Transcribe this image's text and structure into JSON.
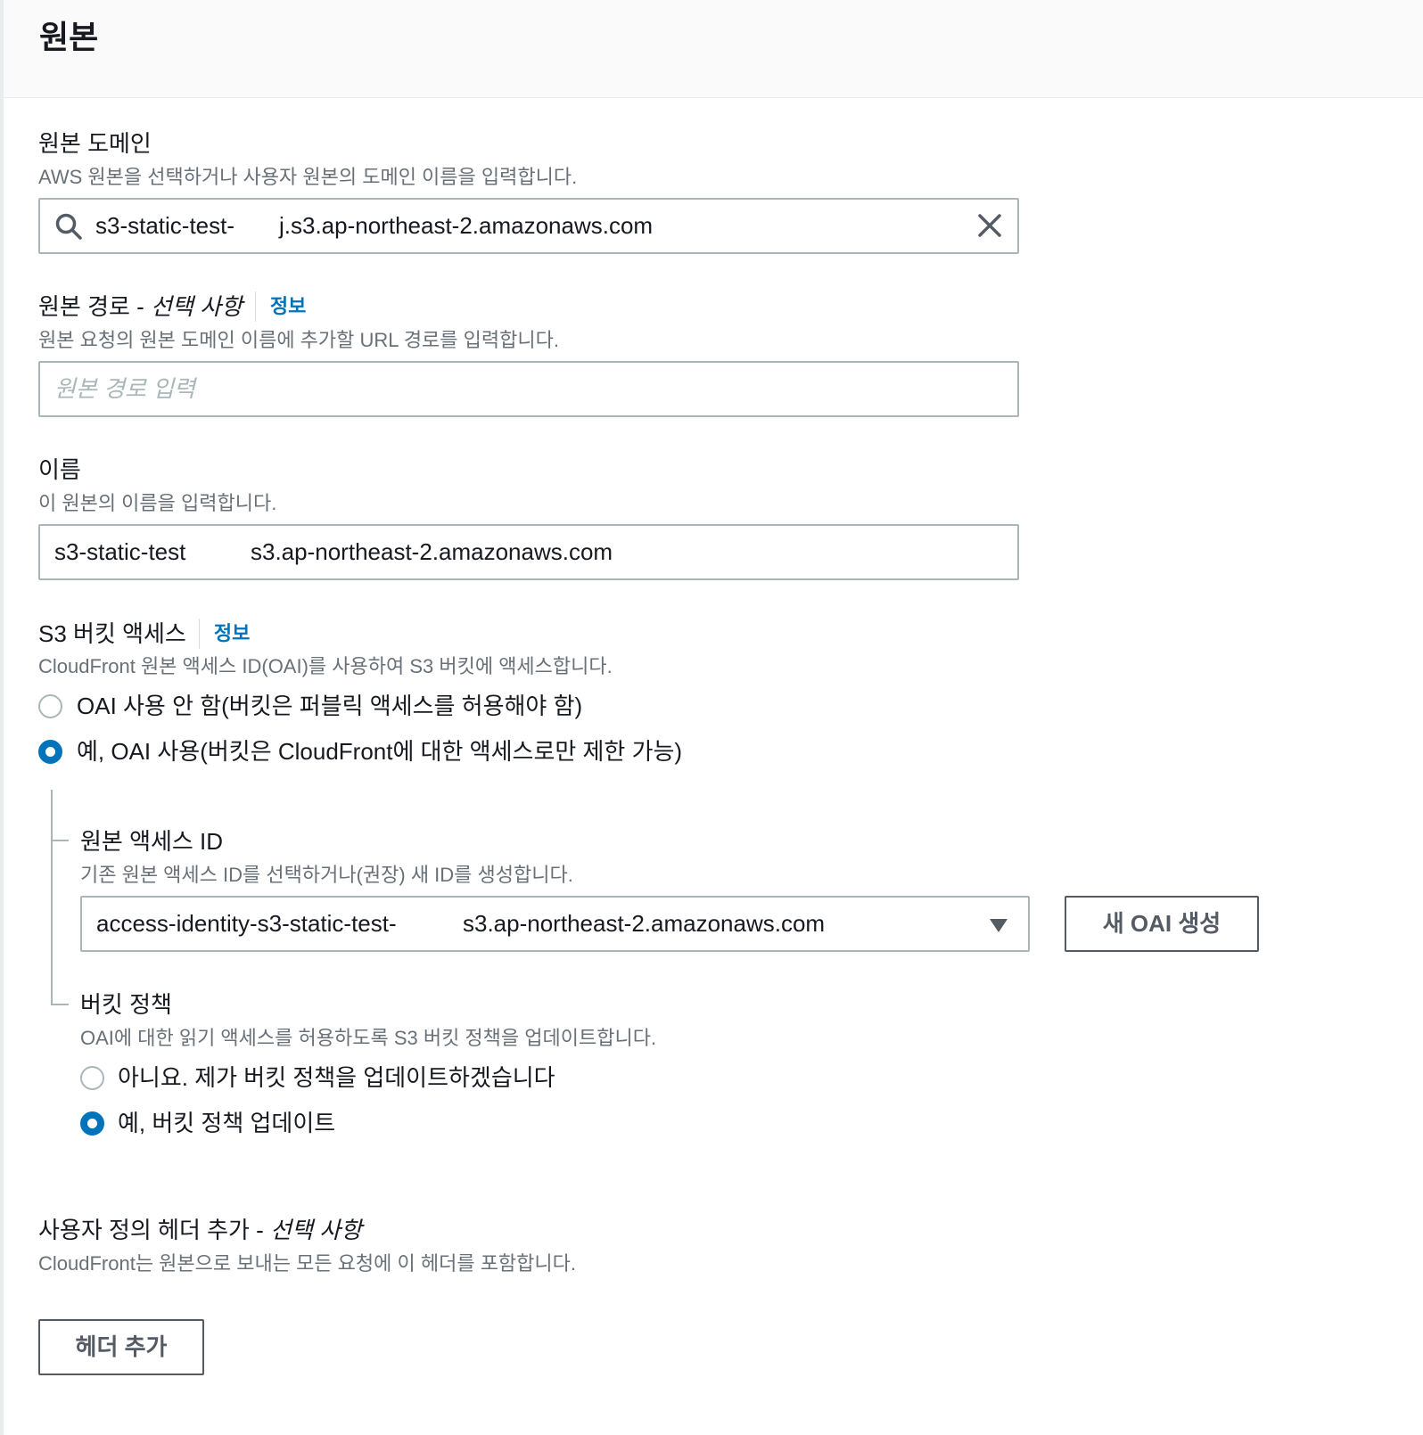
{
  "header": {
    "title": "원본"
  },
  "origin_domain": {
    "label": "원본 도메인",
    "description": "AWS 원본을 선택하거나 사용자 원본의 도메인 이름을 입력합니다.",
    "value_part1": "s3-static-test-",
    "value_part2": "j.s3.ap-northeast-2.amazonaws.com"
  },
  "origin_path": {
    "label_main": "원본 경로 - ",
    "label_optional": "선택 사항",
    "info_link": "정보",
    "description": "원본 요청의 원본 도메인 이름에 추가할 URL 경로를 입력합니다.",
    "placeholder": "원본 경로 입력"
  },
  "name": {
    "label": "이름",
    "description": "이 원본의 이름을 입력합니다.",
    "value_part1": "s3-static-test",
    "value_part2": "s3.ap-northeast-2.amazonaws.com"
  },
  "s3_access": {
    "label": "S3 버킷 액세스",
    "info_link": "정보",
    "description": "CloudFront 원본 액세스 ID(OAI)를 사용하여 S3 버킷에 액세스합니다.",
    "options": [
      {
        "label": "OAI 사용 안 함(버킷은 퍼블릭 액세스를 허용해야 함)",
        "selected": false
      },
      {
        "label": "예, OAI 사용(버킷은 CloudFront에 대한 액세스로만 제한 가능)",
        "selected": true
      }
    ]
  },
  "oai": {
    "label": "원본 액세스 ID",
    "description": "기존 원본 액세스 ID를 선택하거나(권장) 새 ID를 생성합니다.",
    "value_part1": "access-identity-s3-static-test-",
    "value_part2": "s3.ap-northeast-2.amazonaws.com",
    "create_button": "새 OAI 생성"
  },
  "bucket_policy": {
    "label": "버킷 정책",
    "description": "OAI에 대한 읽기 액세스를 허용하도록 S3 버킷 정책을 업데이트합니다.",
    "options": [
      {
        "label": "아니요. 제가 버킷 정책을 업데이트하겠습니다",
        "selected": false
      },
      {
        "label": "예, 버킷 정책 업데이트",
        "selected": true
      }
    ]
  },
  "custom_headers": {
    "label_main": "사용자 정의 헤더 추가 - ",
    "label_optional": "선택 사항",
    "description": "CloudFront는 원본으로 보내는 모든 요청에 이 헤더를 포함합니다.",
    "add_button": "헤더 추가"
  },
  "colors": {
    "accent": "#0073bb",
    "border": "#aab7b8",
    "muted_text": "#687078",
    "text": "#16191f"
  },
  "icons": {
    "search": "search-icon",
    "clear": "close-icon",
    "dropdown": "caret-down-icon"
  }
}
